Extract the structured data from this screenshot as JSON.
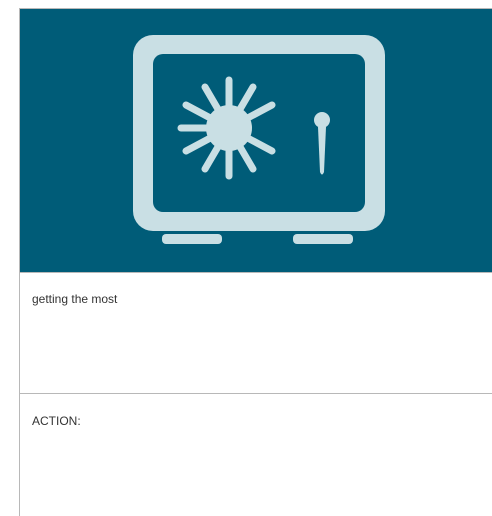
{
  "hero": {
    "icon": "safe-icon",
    "background_color": "#005c78",
    "icon_color": "#c9dfe4"
  },
  "rows": [
    {
      "text": "getting the most"
    },
    {
      "text": "ACTION:"
    }
  ]
}
